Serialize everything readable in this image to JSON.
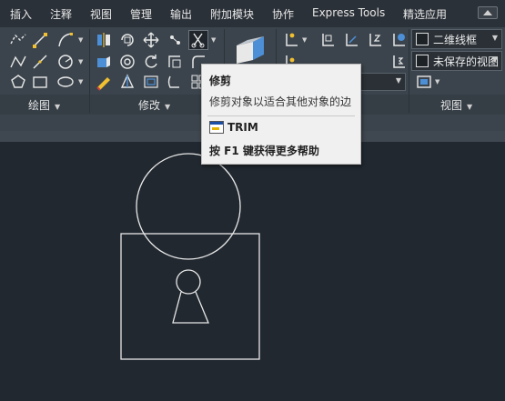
{
  "menu_tabs": [
    "插入",
    "注释",
    "视图",
    "管理",
    "输出",
    "附加模块",
    "协作",
    "Express Tools",
    "精选应用"
  ],
  "panels": {
    "draw": "绘图",
    "modify": "修改",
    "view": "视图"
  },
  "visual_style": {
    "current": "二维线框",
    "saved_view": "未保存的视图"
  },
  "tooltip": {
    "title": "修剪",
    "description": "修剪对象以适合其他对象的边",
    "command": "TRIM",
    "help": "按 F1 键获得更多帮助"
  },
  "colors": {
    "canvas_background": "#212830",
    "ribbon_background": "#3b444c",
    "drawing_lines": "#e8e8e8",
    "tooltip_background": "#f0f0f0"
  },
  "icons": [
    "polyline-icon",
    "line-icon",
    "arc-icon",
    "circle-icon",
    "polygon-icon",
    "rectangle-icon",
    "ellipse-icon",
    "mirror-icon",
    "rotate-icon",
    "move-icon",
    "trim-icon",
    "fillet-icon",
    "copy-icon",
    "stretch-icon",
    "scale-icon",
    "array-icon",
    "erase-icon",
    "explode-icon",
    "offset-icon",
    "view-cube-icon",
    "ucs-icon"
  ]
}
